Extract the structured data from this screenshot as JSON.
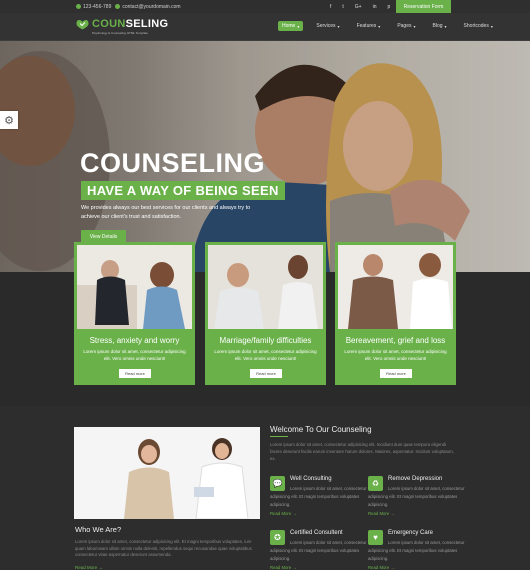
{
  "topbar": {
    "phone": "123-456-789",
    "email": "contact@yourdomain.com",
    "social": [
      "f",
      "t",
      "G+",
      "in",
      "p"
    ],
    "reservation_label": "Reservation Form"
  },
  "brand": {
    "name_prefix": "COUN",
    "name_suffix": "SELING",
    "tagline": "Psychology & Counseling HTML Template"
  },
  "menu": [
    {
      "label": "Home",
      "active": true
    },
    {
      "label": "Services",
      "active": false
    },
    {
      "label": "Features",
      "active": false
    },
    {
      "label": "Pages",
      "active": false
    },
    {
      "label": "Blog",
      "active": false
    },
    {
      "label": "Shortcodes",
      "active": false
    }
  ],
  "hero": {
    "title": "COUNSELING",
    "subtitle": "HAVE A WAY OF BEING SEEN",
    "text": "We provides always our best services for our clients and always try to achieve our client's trust and satisfaction.",
    "button": "View Details"
  },
  "cards": [
    {
      "title": "Stress, anxiety and worry",
      "text": "Lorem ipsum dolor sit amet, consectetur adipisicing elit. Vero omnis unde nesciunt!",
      "button": "Read more"
    },
    {
      "title": "Marriage/family difficulties",
      "text": "Lorem ipsum dolor sit amet, consectetur adipisicing elit. Vero omnis unde nesciunt!",
      "button": "Read more"
    },
    {
      "title": "Bereavement, grief and loss",
      "text": "Lorem ipsum dolor sit amet, consectetur adipisicing elit. Vero omnis unde nesciunt!",
      "button": "Read more"
    }
  ],
  "about": {
    "title": "Who We Are?",
    "text": "Lorem ipsum dolor sit amet, consectetur adipisicing elit. Et magni temporibus voluptates, iure quam laboriosam ullam omnis nulla deleniti, repellendus sequi recusandae quae voluptatibus consectetur vitae aspernatur deserunt assumenda.",
    "read_more": "Read More →"
  },
  "welcome": {
    "title": "Welcome To Our Counseling",
    "text": "Lorem ipsum dolor sit amet, consectetur adipisicing elit. Incidiunt dum quae tempora eligendi facere deserunt facilis earum inventore harum dolores. Maiores, aspernatur. Incidunt voluptatum, ex."
  },
  "services": [
    {
      "title": "Well Consulting",
      "icon": "chat-icon",
      "text": "Lorem ipsum dolor sit amet, consectetur adipisicing elit. Et magni temporibus voluptates adipiscing.",
      "read_more": "Read More →"
    },
    {
      "title": "Remove Depression",
      "icon": "recycle-icon",
      "text": "Lorem ipsum dolor sit amet, consectetur adipisicing elit. Et magni temporibus voluptates adipiscing.",
      "read_more": "Read More →"
    },
    {
      "title": "Certified Consultent",
      "icon": "badge-icon",
      "text": "Lorem ipsum dolor sit amet, consectetur adipisicing elit. Et magni temporibus voluptates adipiscing.",
      "read_more": "Read More →"
    },
    {
      "title": "Emergency Care",
      "icon": "heart-icon",
      "text": "Lorem ipsum dolor sit amet, consectetur adipisicing elit. Et magni temporibus voluptates adipiscing.",
      "read_more": "Read More →"
    }
  ],
  "colors": {
    "accent": "#6ab14a",
    "dark": "#2b2b2b"
  }
}
